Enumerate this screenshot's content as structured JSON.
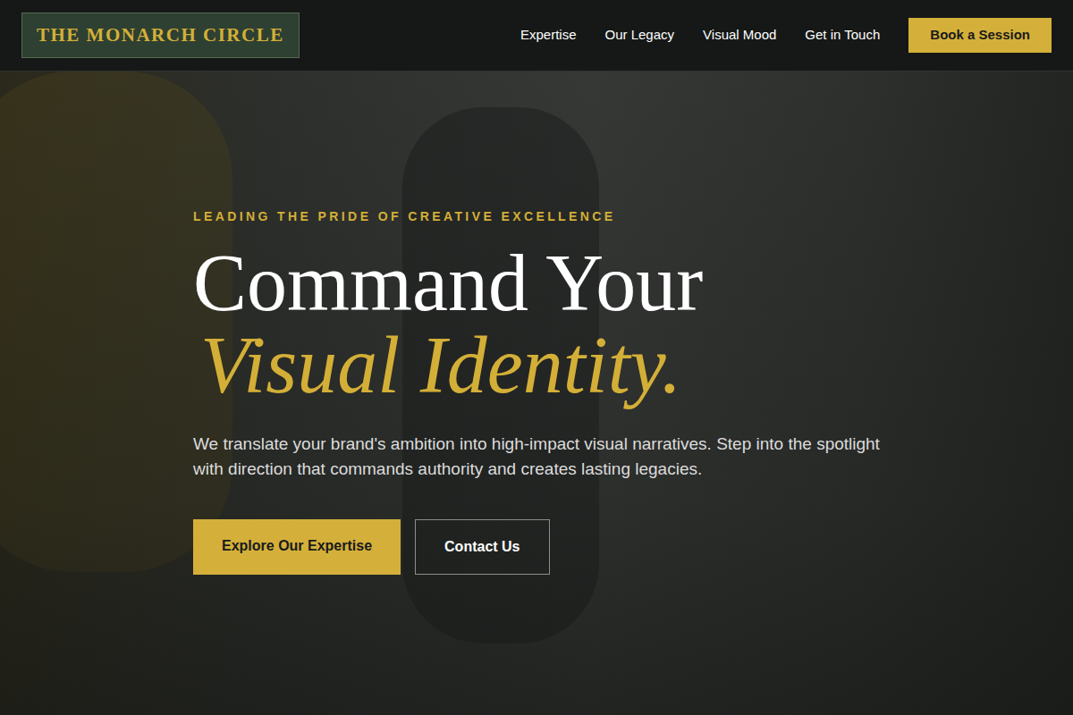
{
  "brand": {
    "name": "THE MONARCH CIRCLE"
  },
  "nav": {
    "links": [
      {
        "label": "Expertise"
      },
      {
        "label": "Our Legacy"
      },
      {
        "label": "Visual Mood"
      },
      {
        "label": "Get in Touch"
      }
    ],
    "cta": "Book a Session"
  },
  "hero": {
    "eyebrow": "LEADING THE PRIDE OF CREATIVE EXCELLENCE",
    "title_line1": "Command Your",
    "title_line2": "Visual Identity.",
    "description": "We translate your brand's ambition into high-impact visual narratives. Step into the spotlight with direction that commands authority and creates lasting legacies.",
    "buttons": [
      "Explore Our Expertise",
      "Contact Us"
    ]
  }
}
